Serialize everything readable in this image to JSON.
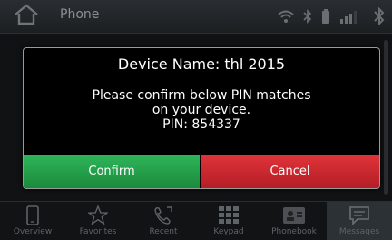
{
  "topbar": {
    "title": "Phone",
    "icons": [
      "home-icon",
      "wifi-icon",
      "bluetooth-icon",
      "battery-icon",
      "signal-icon",
      "bluetooth-icon"
    ]
  },
  "dialog": {
    "device_name": "Device Name: thl 2015",
    "message_line1": "Please confirm below PIN matches",
    "message_line2": "on your device.",
    "pin_line": "PIN: 854337",
    "confirm_label": "Confirm",
    "cancel_label": "Cancel",
    "confirm_color": "#22a04a",
    "cancel_color": "#cc2a30"
  },
  "nav": {
    "items": [
      {
        "label": "Overview",
        "icon": "phone-icon"
      },
      {
        "label": "Favorites",
        "icon": "star-icon"
      },
      {
        "label": "Recent",
        "icon": "recent-calls-icon"
      },
      {
        "label": "Keypad",
        "icon": "keypad-icon"
      },
      {
        "label": "Phonebook",
        "icon": "phonebook-icon"
      },
      {
        "label": "Messages",
        "icon": "message-icon"
      }
    ],
    "active": "Messages"
  }
}
